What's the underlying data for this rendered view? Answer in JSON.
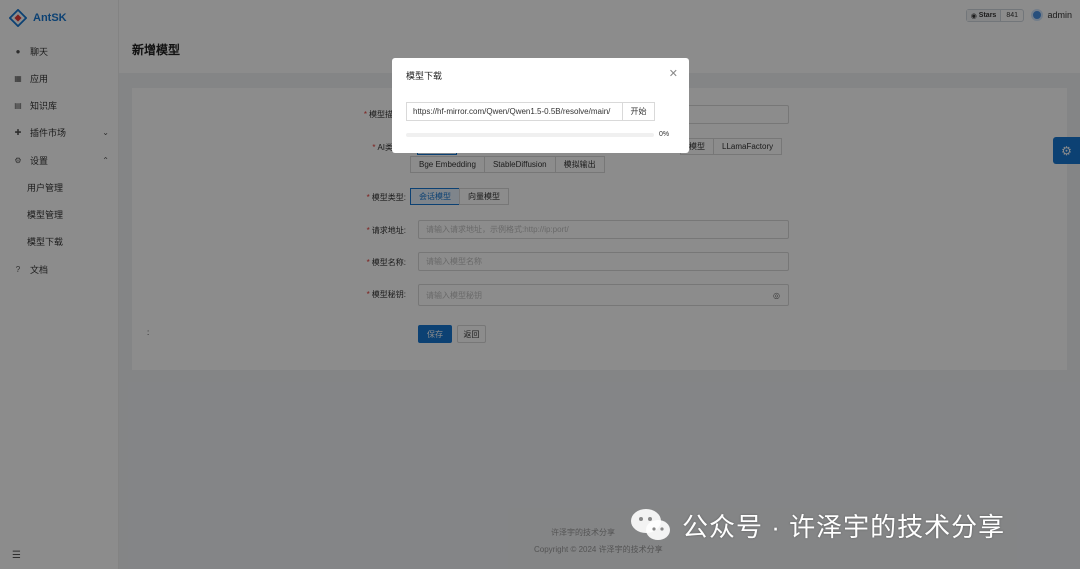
{
  "app": {
    "name": "AntSK"
  },
  "sidebar": {
    "items": [
      {
        "label": "聊天",
        "icon": "chat-icon"
      },
      {
        "label": "应用",
        "icon": "apps-icon"
      },
      {
        "label": "知识库",
        "icon": "book-icon"
      },
      {
        "label": "插件市场",
        "icon": "plugin-icon"
      },
      {
        "label": "设置",
        "icon": "settings-icon"
      },
      {
        "label": "文档",
        "icon": "help-icon"
      }
    ],
    "sub_items": [
      "用户管理",
      "模型管理",
      "模型下载"
    ]
  },
  "header": {
    "stars_label": "Stars",
    "stars_count": "841",
    "user": "admin"
  },
  "page": {
    "title": "新增模型"
  },
  "form": {
    "name_label": "模型描",
    "ai_label": "AI类",
    "ai_options_row1_partial": [
      "模型",
      "LLamaFactory"
    ],
    "ai_options_row2": [
      "Bge Embedding",
      "StableDiffusion",
      "模拟输出"
    ],
    "type_label": "模型类型:",
    "type_options": [
      "会话模型",
      "向量模型"
    ],
    "endpoint_label": "请求地址:",
    "endpoint_placeholder": "请输入请求地址，示例格式:http://ip:port/",
    "model_name_label": "模型名称:",
    "model_name_placeholder": "请输入模型名称",
    "key_label": "模型秘钥:",
    "key_placeholder": "请输入模型秘钥",
    "save": "保存",
    "back": "返回",
    "colon": ":"
  },
  "modal": {
    "title": "模型下载",
    "url": "https://hf-mirror.com/Qwen/Qwen1.5-0.5B/resolve/main/",
    "start": "开始",
    "progress": 0,
    "progress_text": "0%"
  },
  "footer": {
    "line1": "许泽宇的技术分享",
    "line2": "Copyright © 2024 许泽宇的技术分享"
  },
  "watermark": {
    "text": "公众号 · 许泽宇的技术分享"
  },
  "colors": {
    "primary": "#1677d2",
    "required": "#e53935"
  }
}
